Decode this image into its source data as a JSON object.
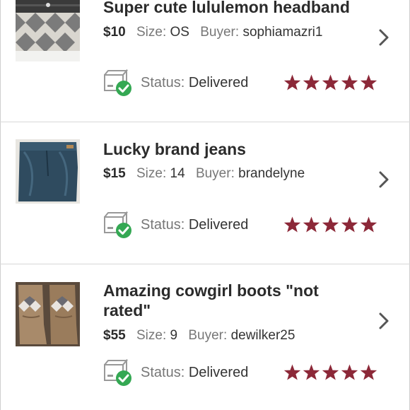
{
  "labels": {
    "size": "Size:",
    "buyer": "Buyer:",
    "status": "Status:"
  },
  "colors": {
    "star": "#8c2838",
    "check": "#34a853",
    "chevron": "#555555"
  },
  "items": [
    {
      "title": "Super cute lululemon headband",
      "price": "$10",
      "size": "OS",
      "buyer": "sophiamazri1",
      "status": "Delivered",
      "rating": 5
    },
    {
      "title": "Lucky brand jeans",
      "price": "$15",
      "size": "14",
      "buyer": "brandelyne",
      "status": "Delivered",
      "rating": 5
    },
    {
      "title": "Amazing cowgirl boots \"not rated\"",
      "price": "$55",
      "size": "9",
      "buyer": "dewilker25",
      "status": "Delivered",
      "rating": 5
    }
  ]
}
